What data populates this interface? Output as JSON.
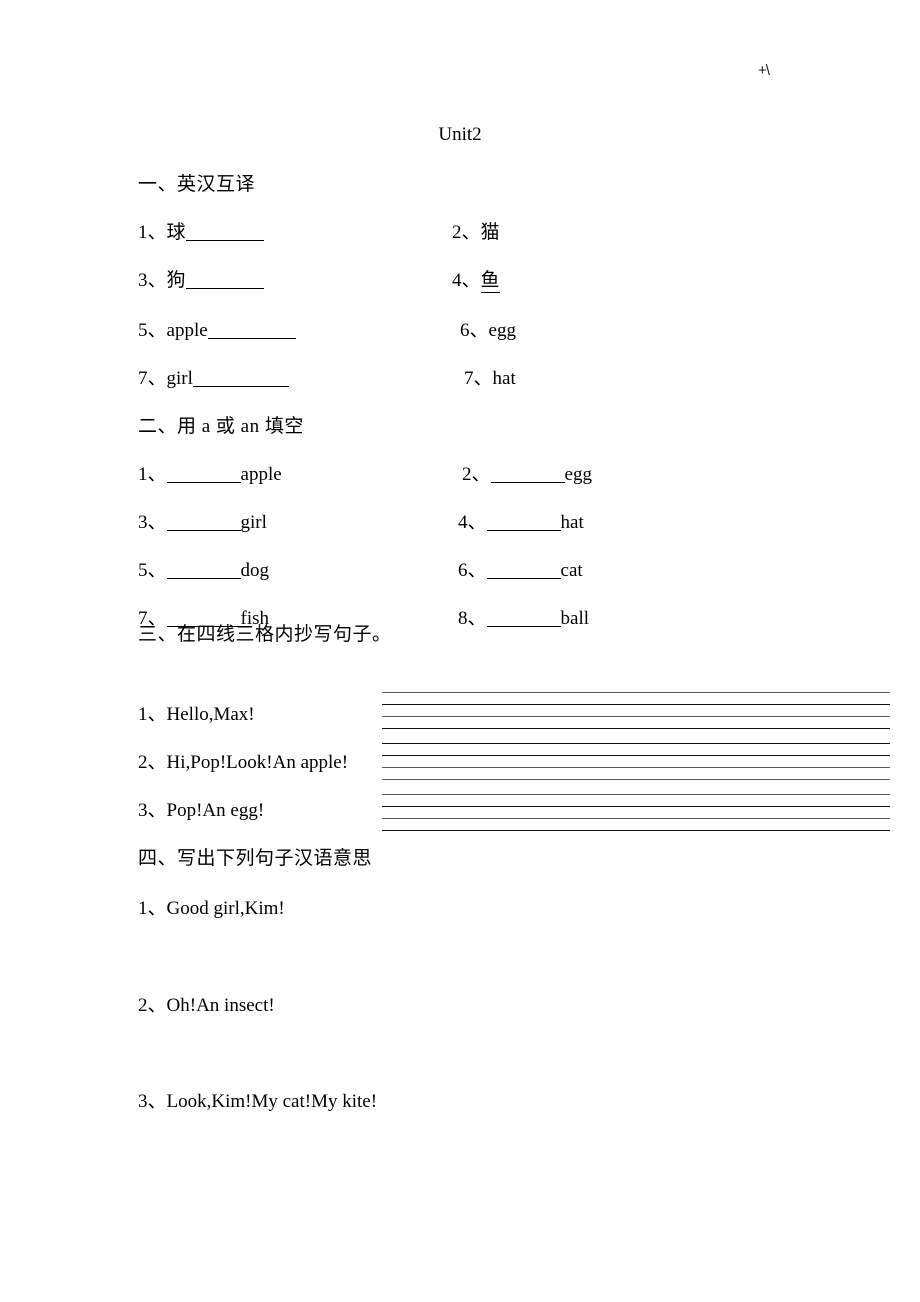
{
  "page": {
    "corner_mark": "+\\",
    "title": "Unit2"
  },
  "sections": [
    {
      "heading": "一、英汉互译",
      "items_left": [
        {
          "num": "1、",
          "word": "球",
          "blank": true
        },
        {
          "num": "3、",
          "word": "狗",
          "blank": true
        },
        {
          "num": "5、",
          "word": "apple",
          "blank": true
        },
        {
          "num": "7、",
          "word": "girl",
          "blank": true
        }
      ],
      "items_right": [
        {
          "num": "2、",
          "word": "猫",
          "underlined": false
        },
        {
          "num": "4、",
          "word": "鱼",
          "underlined": true
        },
        {
          "num": "6、",
          "word": "egg",
          "underlined": false
        },
        {
          "num": "7、",
          "word": "hat",
          "underlined": false
        }
      ]
    },
    {
      "heading": "二、用 a 或 an 填空",
      "items_left": [
        {
          "num": "1、",
          "word": "apple"
        },
        {
          "num": "3、",
          "word": "girl"
        },
        {
          "num": "5、",
          "word": "dog"
        },
        {
          "num": "7、",
          "word": "fish"
        }
      ],
      "items_right": [
        {
          "num": "2、",
          "word": "egg"
        },
        {
          "num": "4、",
          "word": "hat"
        },
        {
          "num": "6、",
          "word": "cat"
        },
        {
          "num": "8、",
          "word": "ball"
        }
      ]
    },
    {
      "heading": "三、在四线三格内抄写句子。",
      "sentences": [
        {
          "num": "1、",
          "text": "Hello,Max!"
        },
        {
          "num": "2、",
          "text": "Hi,Pop!Look!An apple!"
        },
        {
          "num": "3、",
          "text": "Pop!An egg!"
        }
      ],
      "rule_groups": 3,
      "rules_per_group": 4
    },
    {
      "heading": "四、写出下列句子汉语意思",
      "sentences": [
        {
          "num": "1、",
          "text": "Good girl,Kim!"
        },
        {
          "num": "2、",
          "text": "Oh!An insect!"
        },
        {
          "num": "3、",
          "text": "Look,Kim!My cat!My kite!"
        }
      ]
    }
  ]
}
